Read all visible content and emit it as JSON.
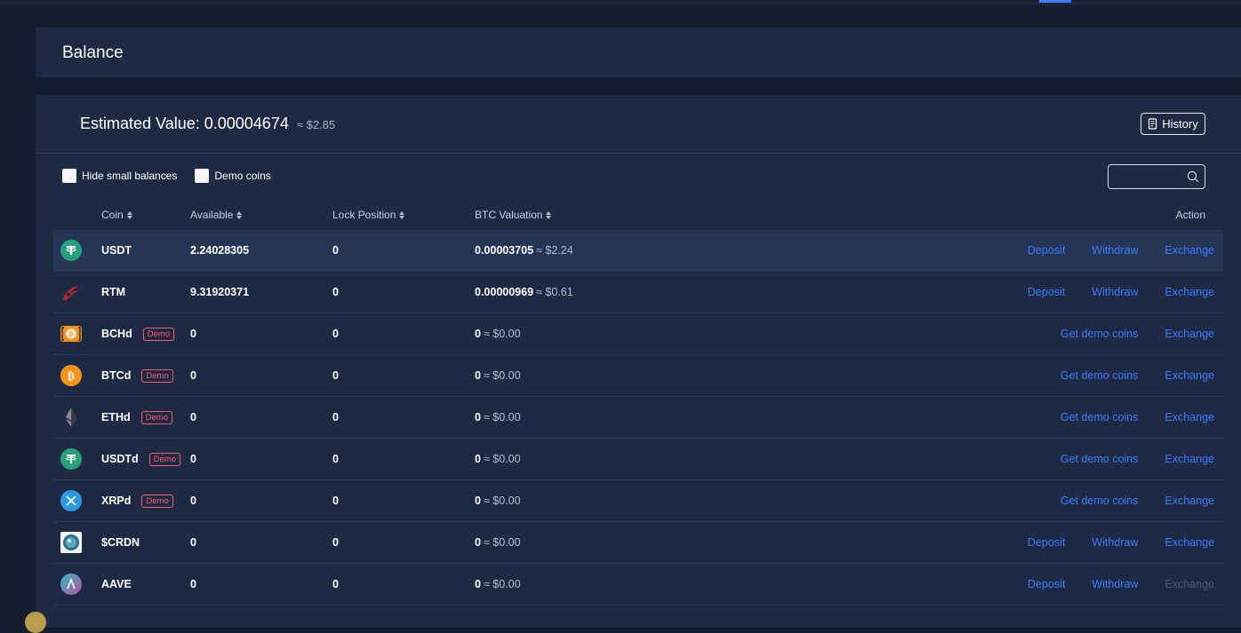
{
  "header": {
    "title": "Balance"
  },
  "summary": {
    "estimated_label": "Estimated Value: 0.00004674",
    "estimated_usd": "≈ $2.85",
    "history_label": "History"
  },
  "filters": {
    "hide_small": "Hide small balances",
    "demo_coins": "Demo coins",
    "search_placeholder": ""
  },
  "columns": {
    "coin": "Coin",
    "available": "Available",
    "lock": "Lock Position",
    "btc": "BTC Valuation",
    "action": "Action"
  },
  "rows": [
    {
      "coin": "USDT",
      "icon": "usdt-icon",
      "demo": "",
      "available": "2.24028305",
      "lock": "0",
      "btc": "0.00003705",
      "usd": "≈ $2.24",
      "actions": [
        "Deposit",
        "Withdraw",
        "Exchange"
      ]
    },
    {
      "coin": "RTM",
      "icon": "rtm-icon",
      "demo": "",
      "available": "9.31920371",
      "lock": "0",
      "btc": "0.00000969",
      "usd": "≈ $0.61",
      "actions": [
        "Deposit",
        "Withdraw",
        "Exchange"
      ]
    },
    {
      "coin": "BCHd",
      "icon": "bch-icon",
      "demo": "Demo",
      "available": "0",
      "lock": "0",
      "btc": "0",
      "usd": "≈ $0.00",
      "actions": [
        "Get demo coins",
        "Exchange"
      ]
    },
    {
      "coin": "BTCd",
      "icon": "btc-icon",
      "demo": "Demo",
      "available": "0",
      "lock": "0",
      "btc": "0",
      "usd": "≈ $0.00",
      "actions": [
        "Get demo coins",
        "Exchange"
      ]
    },
    {
      "coin": "ETHd",
      "icon": "eth-icon",
      "demo": "Demo",
      "available": "0",
      "lock": "0",
      "btc": "0",
      "usd": "≈ $0.00",
      "actions": [
        "Get demo coins",
        "Exchange"
      ]
    },
    {
      "coin": "USDTd",
      "icon": "usdt-icon",
      "demo": "Demo",
      "available": "0",
      "lock": "0",
      "btc": "0",
      "usd": "≈ $0.00",
      "actions": [
        "Get demo coins",
        "Exchange"
      ]
    },
    {
      "coin": "XRPd",
      "icon": "xrp-icon",
      "demo": "Demo",
      "available": "0",
      "lock": "0",
      "btc": "0",
      "usd": "≈ $0.00",
      "actions": [
        "Get demo coins",
        "Exchange"
      ]
    },
    {
      "coin": "$CRDN",
      "icon": "crdn-icon",
      "demo": "",
      "available": "0",
      "lock": "0",
      "btc": "0",
      "usd": "≈ $0.00",
      "actions": [
        "Deposit",
        "Withdraw",
        "Exchange"
      ]
    },
    {
      "coin": "AAVE",
      "icon": "aave-icon",
      "demo": "",
      "available": "0",
      "lock": "0",
      "btc": "0",
      "usd": "≈ $0.00",
      "actions": [
        "Deposit",
        "Withdraw",
        "Exchange"
      ],
      "disabled_actions": [
        "Exchange"
      ]
    }
  ],
  "colors": {
    "accent": "#3a7bff",
    "demo": "#ff5a6a",
    "panel": "#1e2a44"
  }
}
